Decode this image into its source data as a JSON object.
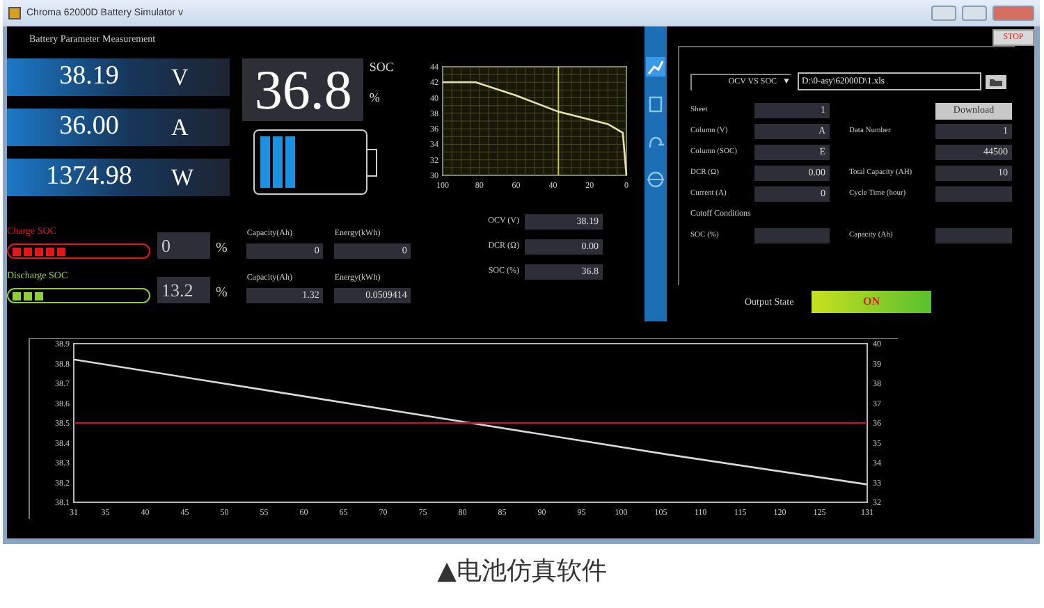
{
  "window": {
    "title": "Chroma 62000D Battery Simulator v"
  },
  "measurement": {
    "title": "Battery Parameter Measurement",
    "readings": [
      {
        "value": "38.19",
        "unit": "V"
      },
      {
        "value": "36.00",
        "unit": "A"
      },
      {
        "value": "1374.98",
        "unit": "W"
      }
    ]
  },
  "soc": {
    "value": "36.8",
    "label": "SOC",
    "unit": "%",
    "level": 0.368
  },
  "ocv_chart": {
    "chart_data": {
      "type": "line",
      "x": [
        100,
        82,
        60,
        37,
        10,
        2,
        0
      ],
      "series": [
        {
          "color": "#e8e2b0",
          "values": [
            42,
            42,
            40.3,
            38.2,
            36.6,
            35.5,
            30
          ]
        }
      ],
      "xlim": [
        100,
        0
      ],
      "ylim": [
        30,
        44
      ],
      "xticks": [
        100,
        80,
        60,
        40,
        20,
        0
      ],
      "yticks": [
        30,
        32,
        34,
        36,
        38,
        40,
        42,
        44
      ],
      "grid": true,
      "ref_lines": [
        {
          "axis": "x",
          "value": 37,
          "color": "#c8c850"
        }
      ]
    }
  },
  "soc_meters": [
    {
      "label": "Charge SOC",
      "color": "#e01818",
      "level": 0.42,
      "value": "0",
      "unit": "%",
      "capacity_label": "Capacity(Ah)",
      "capacity": "0",
      "energy_label": "Energy(kWh)",
      "energy": "0"
    },
    {
      "label": "Discharge SOC",
      "color": "#8ccf3a",
      "level": 0.25,
      "value": "13.2",
      "unit": "%",
      "capacity_label": "Capacity(Ah)",
      "capacity": "1.32",
      "energy_label": "Energy(kWh)",
      "energy": "0.0509414"
    }
  ],
  "readouts": [
    {
      "label": "OCV (V)",
      "value": "38.19"
    },
    {
      "label": "DCR (Ω)",
      "value": "0.00"
    },
    {
      "label": "SOC (%)",
      "value": "36.8"
    }
  ],
  "side_tabs": [
    {
      "kind": "curve",
      "selected": true
    },
    {
      "kind": "document",
      "selected": false
    },
    {
      "kind": "plug",
      "selected": false
    },
    {
      "kind": "globe",
      "selected": false
    }
  ],
  "stop_button": "STOP",
  "profile": {
    "mode": "OCV VS SOC",
    "mode_caret": "▼",
    "file_path": "D:\\0-asy\\62000D\\1.xls",
    "left_fields": [
      {
        "label": "Sheet",
        "value": "1"
      },
      {
        "label": "Column (V)",
        "value": "A"
      },
      {
        "label": "Column (SOC)",
        "value": "E"
      },
      {
        "label": "DCR (Ω)",
        "value": "0.00"
      },
      {
        "label": "Current (A)",
        "value": "0"
      }
    ],
    "right_fields": [
      {
        "kind": "button",
        "label": "Download"
      },
      {
        "kind": "field",
        "label": "Data Number",
        "value": "1"
      },
      {
        "kind": "field",
        "value": "44500"
      },
      {
        "kind": "field",
        "label": "Total Capacity (AH)",
        "value": "10"
      },
      {
        "kind": "field",
        "label": "Cycle Time (hour)"
      }
    ],
    "cutoff": {
      "title": "Cutoff Conditions",
      "fields": [
        {
          "label": "SOC (%)"
        },
        {
          "label": "Capacity (Ah)"
        }
      ]
    }
  },
  "output_state": {
    "label": "Output State",
    "value": "ON",
    "on": true
  },
  "trend": {
    "chart_data": {
      "type": "line",
      "x": [
        31,
        56,
        81,
        106,
        131
      ],
      "series": [
        {
          "color": "#d8d8d8",
          "values": [
            38.82,
            38.66,
            38.5,
            38.34,
            38.19
          ]
        },
        {
          "color": "#b01c2c",
          "values": [
            38.5,
            38.5,
            38.5,
            38.5,
            38.5
          ]
        }
      ],
      "xlim": [
        31,
        131
      ],
      "ylim": [
        38.1,
        38.9
      ],
      "xticks": [
        31,
        35,
        40,
        45,
        50,
        55,
        60,
        65,
        70,
        75,
        80,
        85,
        90,
        95,
        100,
        105,
        110,
        115,
        120,
        125,
        131
      ],
      "yticks": [
        38.1,
        38.2,
        38.3,
        38.4,
        38.5,
        38.6,
        38.7,
        38.8,
        38.9
      ]
    },
    "right_axis_ticks": [
      "40",
      "39",
      "38",
      "37",
      "36",
      "35",
      "34",
      "33",
      "32"
    ]
  },
  "caption": "▲电池仿真软件"
}
